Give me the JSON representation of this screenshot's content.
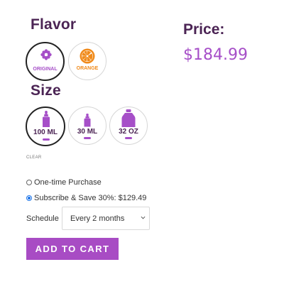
{
  "flavor": {
    "heading": "Flavor",
    "options": [
      {
        "label": "ORIGINAL",
        "icon": "flower-icon",
        "color": "#a64fc8",
        "selected": true
      },
      {
        "label": "ORANGE",
        "icon": "orange-slice-icon",
        "color": "#f08a1a",
        "selected": false
      }
    ]
  },
  "size": {
    "heading": "Size",
    "options": [
      {
        "label": "100 ML",
        "icon": "dropper-bottle-icon",
        "selected": true
      },
      {
        "label": "30 ML",
        "icon": "dropper-bottle-icon",
        "selected": false
      },
      {
        "label": "32 OZ",
        "icon": "jug-bottle-icon",
        "selected": false
      }
    ],
    "clear_label": "CLEAR"
  },
  "price": {
    "heading": "Price:",
    "value": "$184.99"
  },
  "purchase": {
    "one_time_label": "One-time Purchase",
    "subscribe_label": "Subscribe & Save 30%: $129.49",
    "selected": "subscribe"
  },
  "schedule": {
    "label": "Schedule",
    "selected": "Every 2 months"
  },
  "cart": {
    "button_label": "ADD TO CART"
  },
  "colors": {
    "heading": "#4b2454",
    "accent": "#a84cc4",
    "orange": "#f08a1a",
    "radio": "#1a73e8"
  }
}
